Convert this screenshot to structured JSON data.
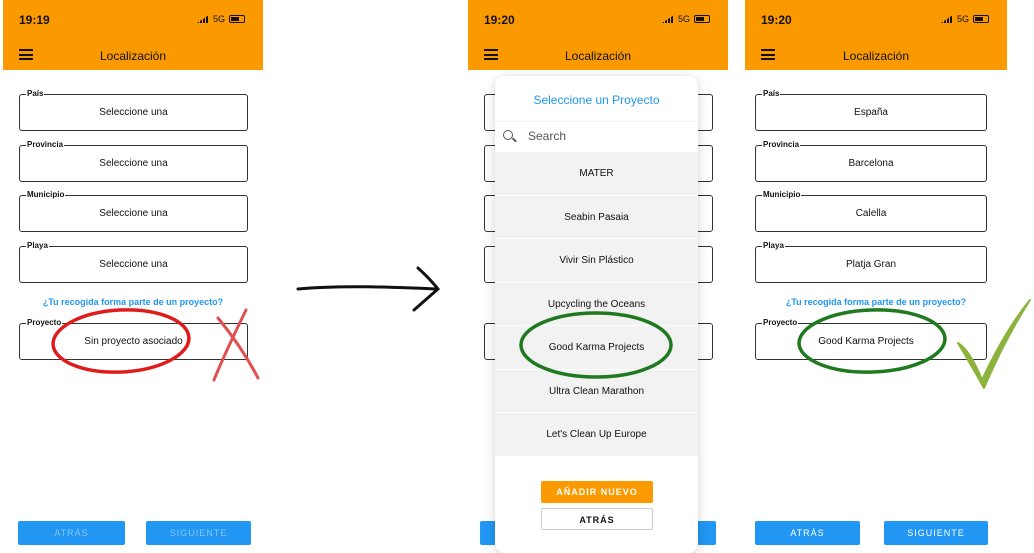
{
  "screens": [
    {
      "time": "19:19",
      "network": "5G",
      "title": "Localización",
      "fields": [
        {
          "label": "País",
          "value": "Seleccione una"
        },
        {
          "label": "Provincia",
          "value": "Seleccione una"
        },
        {
          "label": "Municipio",
          "value": "Seleccione una"
        },
        {
          "label": "Playa",
          "value": "Seleccione una"
        }
      ],
      "project_question": "¿Tu recogida forma parte de un proyecto?",
      "project_field": {
        "label": "Proyecto",
        "value": "Sin proyecto asociado"
      },
      "back_label": "ATRÁS",
      "next_label": "SIGUIENTE"
    },
    {
      "time": "19:20",
      "network": "5G",
      "title": "Localización",
      "modal": {
        "title": "Seleccione un Proyecto",
        "search_placeholder": "Search",
        "projects": [
          "MATER",
          "Seabin Pasaia",
          "Vivir Sin Plástico",
          "Upcycling the Oceans",
          "Good Karma Projects",
          "Ultra Clean Marathon",
          "Let's Clean Up Europe"
        ],
        "add_label": "AÑADIR NUEVO",
        "back_label": "ATRÁS"
      }
    },
    {
      "time": "19:20",
      "network": "5G",
      "title": "Localización",
      "fields": [
        {
          "label": "País",
          "value": "España"
        },
        {
          "label": "Provincia",
          "value": "Barcelona"
        },
        {
          "label": "Municipio",
          "value": "Calella"
        },
        {
          "label": "Playa",
          "value": "Platja Gran"
        }
      ],
      "project_question": "¿Tu recogida forma parte de un proyecto?",
      "project_field": {
        "label": "Proyecto",
        "value": "Good Karma Projects"
      },
      "back_label": "ATRÁS",
      "next_label": "SIGUIENTE"
    }
  ],
  "colors": {
    "header": "#fb9a00",
    "primary": "#2196f3",
    "highlight_wrong": "#e01b1b",
    "highlight_right": "#1f7a1f",
    "check": "#8cb43c"
  },
  "annotations": {
    "arrow": "right-arrow",
    "wrong_mark": "cross-mark",
    "right_mark": "check-mark"
  }
}
